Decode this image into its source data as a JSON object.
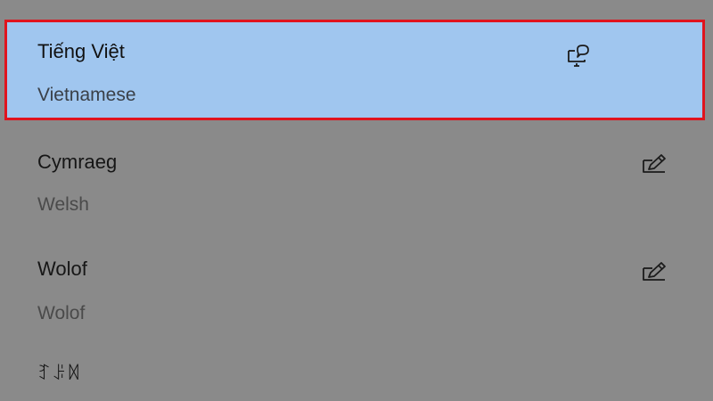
{
  "languages": [
    {
      "native_name": "Tiếng Việt",
      "english_name": "Vietnamese",
      "selected": true,
      "icon": "speech-display-icon"
    },
    {
      "native_name": "Cymraeg",
      "english_name": "Welsh",
      "selected": false,
      "icon": "handwriting-pen-icon"
    },
    {
      "native_name": "Wolof",
      "english_name": "Wolof",
      "selected": false,
      "icon": "handwriting-pen-icon"
    },
    {
      "native_name": "ꆈꌠꉙ",
      "english_name": "",
      "selected": false,
      "icon": ""
    }
  ],
  "colors": {
    "background": "#8a8a8a",
    "selected_fill": "#a0c6ef",
    "selected_border": "#e0141e"
  }
}
